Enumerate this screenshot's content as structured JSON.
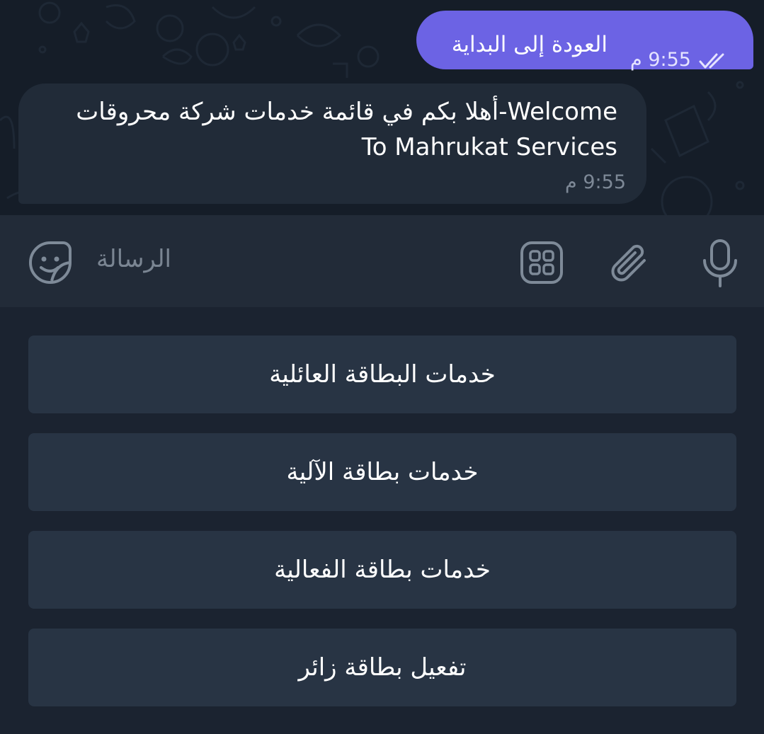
{
  "chat": {
    "outgoing": {
      "text": "العودة إلى البداية",
      "time": "9:55 م",
      "status_icon": "double-check-icon"
    },
    "incoming": {
      "line1": "أهلا بكم في قائمة خدمات شركة محروقات-Welcome",
      "line2": "To Mahrukat Services",
      "time": "9:55 م"
    }
  },
  "input": {
    "placeholder": "الرسالة",
    "icons": [
      "sticker-icon",
      "bot-menu-icon",
      "attach-icon",
      "mic-icon"
    ]
  },
  "keyboard": {
    "buttons": [
      "خدمات البطاقة العائلية",
      "خدمات بطاقة الآلية",
      "خدمات بطاقة الفعالية",
      "تفعيل بطاقة زائر"
    ]
  },
  "colors": {
    "outgoing_bubble": "#6c63e4",
    "incoming_bubble": "#212b38",
    "input_bar": "#222b38",
    "keyboard_bg": "#1b2330",
    "keyboard_button": "#283444",
    "icon": "#7e8a98"
  }
}
